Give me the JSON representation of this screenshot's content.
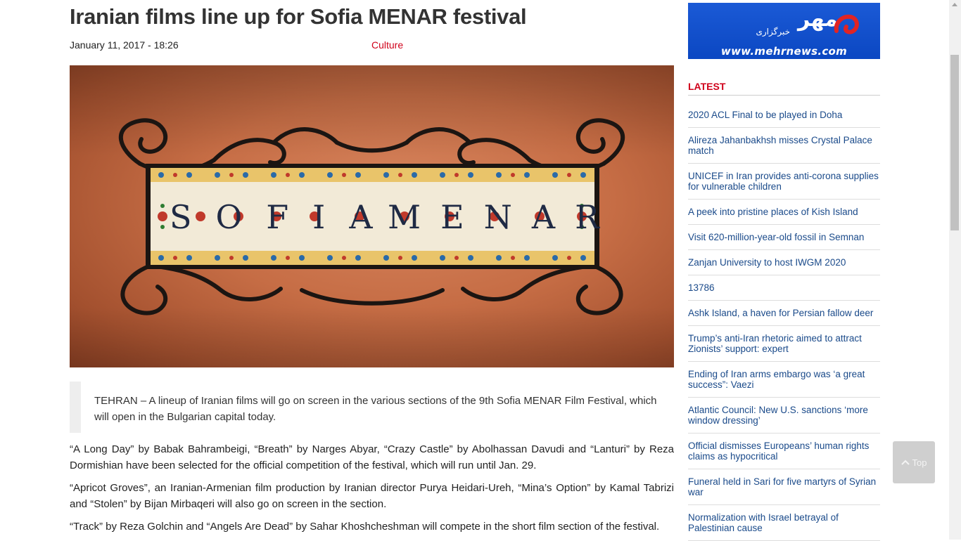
{
  "article": {
    "title": "Iranian films line up for Sofia MENAR festival",
    "date": "January 11, 2017 - 18:26",
    "category": "Culture",
    "image_text_left": "SOFIA",
    "image_text_right": "MENAR",
    "lead": "TEHRAN – A lineup of Iranian films will go on screen in the various sections of the 9th Sofia MENAR Film Festival, which will open in the Bulgarian capital today.",
    "paragraphs": [
      "“A Long Day” by Babak Bahrambeigi, “Breath” by Narges Abyar, “Crazy Castle” by Abolhassan Davudi and “Lanturi” by Reza Dormishian have been selected for the official competition of the festival, which will run until Jan. 29.",
      "“Apricot Groves”, an Iranian-Armenian film production by Iranian director Purya Heidari-Ureh, “Mina’s Option” by Kamal Tabrizi and “Stolen” by Bijan Mirbaqeri will also go on screen in the section.",
      "“Track” by Reza Golchin and “Angels Are Dead” by Sahar Khoshcheshman will compete in the short film section of the festival."
    ]
  },
  "sidebar": {
    "logo_url": "www.mehrnews.com",
    "logo_persian": "مهر",
    "logo_persian_sub": "خبرگزاری",
    "latest_heading": "LATEST",
    "news": [
      "2020 ACL Final to be played in Doha",
      "Alireza Jahanbakhsh misses Crystal Palace match",
      "UNICEF in Iran provides anti-corona supplies for vulnerable children",
      "A peek into pristine places of Kish Island",
      "Visit 620-million-year-old fossil in Semnan",
      "Zanjan University to host IWGM 2020",
      "13786",
      "Ashk Island, a haven for Persian fallow deer",
      "Trump’s anti-Iran rhetoric aimed to attract Zionists’ support: expert",
      "Ending of Iran arms embargo was ‘a great success”: Vaezi",
      "Atlantic Council: New U.S. sanctions ‘more window dressing’",
      "Official dismisses Europeans’ human rights claims as hypocritical",
      "Funeral held in Sari for five martyrs of Syrian war",
      "Normalization with Israel betrayal of Palestinian cause"
    ]
  },
  "top_button": {
    "label": "Top",
    "icon": "chevron-up-icon"
  },
  "colors": {
    "accent_red": "#d0021b",
    "link_blue": "#1a4a8a",
    "logo_blue": "#0b47c2"
  }
}
